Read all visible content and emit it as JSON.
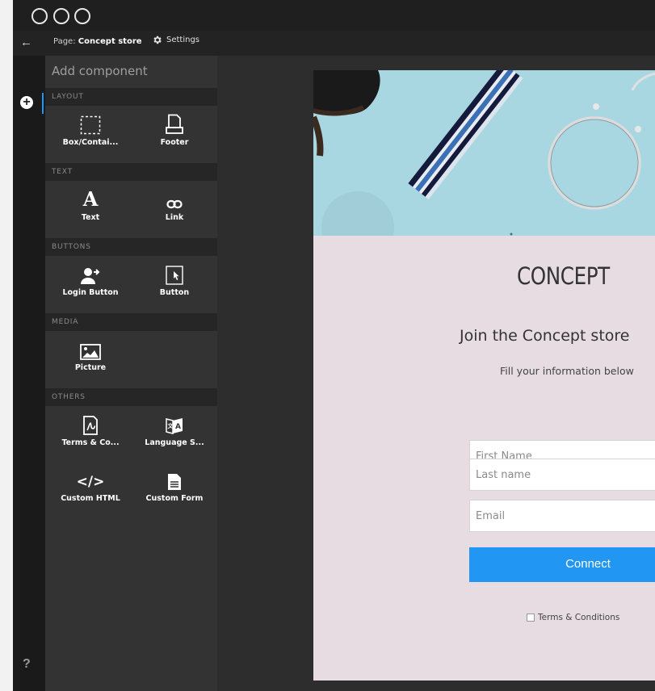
{
  "window": {
    "back_icon": "arrow-left-icon",
    "page_label_prefix": "Page: ",
    "page_name": "Concept store",
    "settings_label": "Settings",
    "settings_icon": "gear-icon"
  },
  "rail": {
    "add_icon": "plus-circle-icon",
    "help_label": "?"
  },
  "panel": {
    "title": "Add component",
    "sections": {
      "layout": "LAYOUT",
      "text": "TEXT",
      "buttons": "BUTTONS",
      "media": "MEDIA",
      "others": "OTHERS"
    },
    "components": {
      "box": "Box/Contai...",
      "footer": "Footer",
      "text": "Text",
      "link": "Link",
      "login_button": "Login Button",
      "button": "Button",
      "picture": "Picture",
      "terms": "Terms & Co...",
      "language": "Language S...",
      "custom_html": "Custom HTML",
      "custom_form": "Custom Form"
    }
  },
  "preview": {
    "logo": "CONCEPT",
    "heading": "Join the Concept store",
    "subheading": "Fill your information below",
    "fields": {
      "first_name_placeholder": "First Name",
      "last_name_placeholder": "Last name",
      "email_placeholder": "Email"
    },
    "connect_label": "Connect",
    "terms_label": "Terms & Conditions"
  },
  "colors": {
    "accent": "#2196f3",
    "page_background": "#e6dce1",
    "hero_background": "#a8d7e2",
    "panel_background": "#333333"
  }
}
